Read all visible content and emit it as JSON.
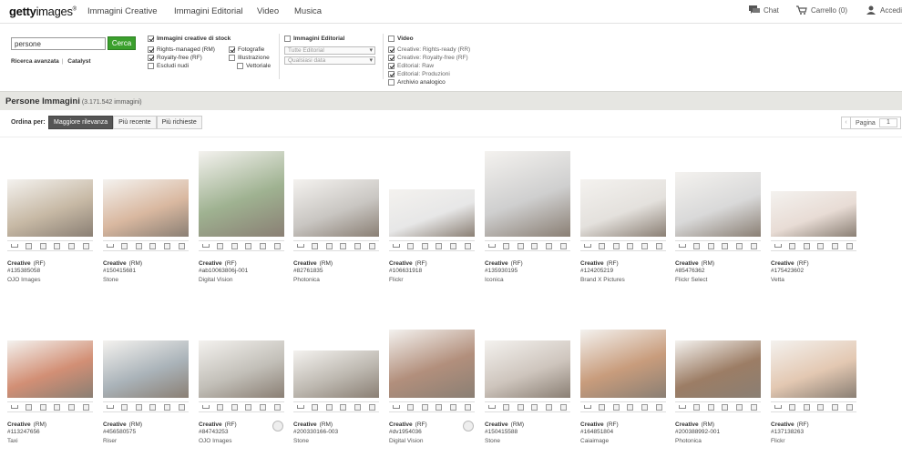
{
  "header": {
    "logo": {
      "bold": "getty",
      "regular": "images",
      "mark": "®"
    },
    "nav": [
      "Immagini Creative",
      "Immagini Editorial",
      "Video",
      "Musica"
    ],
    "chat": "Chat",
    "cart": "Carrello (0)",
    "login": "Accedi"
  },
  "search": {
    "value": "persone",
    "button": "Cerca",
    "advanced": "Ricerca avanzata",
    "catalyst": "Catalyst"
  },
  "filters": {
    "stock": {
      "title": "Immagini creative di stock",
      "items": [
        {
          "label": "Rights-managed (RM)",
          "checked": true
        },
        {
          "label": "Royalty-free (RF)",
          "checked": true
        },
        {
          "label": "Escludi nudi",
          "checked": false
        }
      ],
      "types": [
        {
          "label": "Fotografie",
          "checked": true
        },
        {
          "label": "Illustrazione",
          "checked": false
        },
        {
          "label": "Vettoriale",
          "checked": false
        }
      ]
    },
    "editorial": {
      "title": "Immagini Editorial",
      "select1": "Tutte Editorial",
      "select2": "Qualsiasi data"
    },
    "video": {
      "title": "Video",
      "items": [
        {
          "label": "Creative: Rights-ready (RR)",
          "checked": true
        },
        {
          "label": "Creative: Royalty-free (RF)",
          "checked": true
        },
        {
          "label": "Editorial: Raw",
          "checked": true
        },
        {
          "label": "Editorial: Produzioni",
          "checked": true
        },
        {
          "label": "Archivio analogico",
          "checked": false
        }
      ]
    }
  },
  "results": {
    "title": "Persone Immagini",
    "count": "(3.171.542 immagini)",
    "sort_label": "Ordina per:",
    "sort": [
      "Maggiore rilevanza",
      "Più recente",
      "Più richieste"
    ],
    "page_label": "Pagina",
    "page": "1"
  },
  "images": [
    {
      "lic": "Creative",
      "type": "(RF)",
      "id": "#135385058",
      "src": "OJO Images",
      "color": "#c7b9a5"
    },
    {
      "lic": "Creative",
      "type": "(RM)",
      "id": "#150415681",
      "src": "Stone",
      "color": "#d9b8a0"
    },
    {
      "lic": "Creative",
      "type": "(RF)",
      "id": "#ab10063806j-001",
      "src": "Digital Vision",
      "color": "#9fb291"
    },
    {
      "lic": "Creative",
      "type": "(RM)",
      "id": "#82761835",
      "src": "Photonica",
      "color": "#c9c6c2"
    },
    {
      "lic": "Creative",
      "type": "(RF)",
      "id": "#106631918",
      "src": "Flickr",
      "color": "#e7e7e7"
    },
    {
      "lic": "Creative",
      "type": "(RF)",
      "id": "#135930195",
      "src": "Iconica",
      "color": "#cfcfcf"
    },
    {
      "lic": "Creative",
      "type": "(RF)",
      "id": "#124205219",
      "src": "Brand X Pictures",
      "color": "#e4e1dd"
    },
    {
      "lic": "Creative",
      "type": "(RM)",
      "id": "#85476362",
      "src": "Flickr Select",
      "color": "#d9d9d9"
    },
    {
      "lic": "Creative",
      "type": "(RF)",
      "id": "#175423602",
      "src": "Vetta",
      "color": "#e8dcd5"
    },
    {
      "lic": "Creative",
      "type": "(RM)",
      "id": "#113247656",
      "src": "Taxi",
      "color": "#d28f75"
    },
    {
      "lic": "Creative",
      "type": "(RM)",
      "id": "#456580575",
      "src": "Riser",
      "color": "#aab3b9"
    },
    {
      "lic": "Creative",
      "type": "(RF)",
      "id": "#84743253",
      "src": "OJO Images",
      "color": "#c2bfb8"
    },
    {
      "lic": "Creative",
      "type": "(RM)",
      "id": "#200330166-003",
      "src": "Stone",
      "color": "#bdb8b0"
    },
    {
      "lic": "Creative",
      "type": "(RF)",
      "id": "#dv1954036",
      "src": "Digital Vision",
      "color": "#b28f7c"
    },
    {
      "lic": "Creative",
      "type": "(RM)",
      "id": "#150415588",
      "src": "Stone",
      "color": "#cec5bd"
    },
    {
      "lic": "Creative",
      "type": "(RF)",
      "id": "#164851804",
      "src": "Caiaimage",
      "color": "#c89c7c"
    },
    {
      "lic": "Creative",
      "type": "(RM)",
      "id": "#200388992-001",
      "src": "Photonica",
      "color": "#9c7d65"
    },
    {
      "lic": "Creative",
      "type": "(RF)",
      "id": "#137138263",
      "src": "Flickr",
      "color": "#e3c8b2"
    }
  ]
}
